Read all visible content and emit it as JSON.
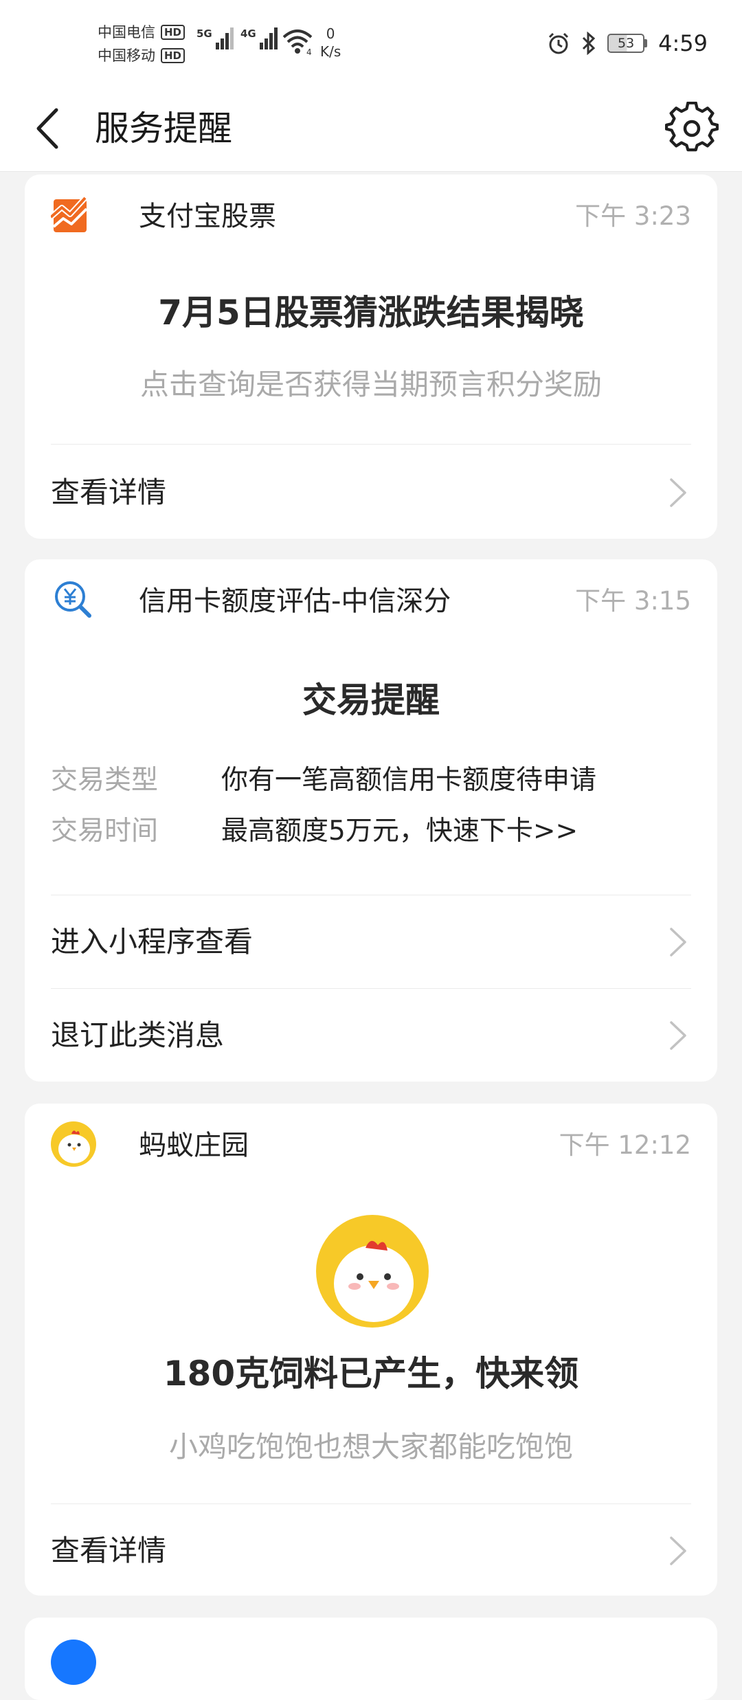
{
  "status_bar": {
    "carrier_1": "中国电信",
    "carrier_2": "中国移动",
    "hd_badge": "HD",
    "sim1_network": "5G",
    "sim2_network": "4G",
    "wifi_badge": "4",
    "speed_value": "0",
    "speed_unit": "K/s",
    "battery": "53",
    "time": "4:59",
    "icons": [
      "signal-icon",
      "wifi-icon",
      "alarm-icon",
      "bluetooth-icon",
      "battery-icon"
    ]
  },
  "header": {
    "title": "服务提醒",
    "icons": [
      "back-arrow-icon",
      "gear-icon"
    ]
  },
  "cards": [
    {
      "service": "支付宝股票",
      "time": "下午 3:23",
      "title": "7月5日股票猜涨跌结果揭晓",
      "subtitle": "点击查询是否获得当期预言积分奖励",
      "link": "查看详情",
      "icon": "stock-chart-icon",
      "icon_color": "#f06a20"
    },
    {
      "service": "信用卡额度评估-中信深分",
      "time": "下午 3:15",
      "title": "交易提醒",
      "fields": [
        {
          "key": "交易类型",
          "value": "你有一笔高额信用卡额度待申请"
        },
        {
          "key": "交易时间",
          "value": "最高额度5万元，快速下卡>>"
        }
      ],
      "links": [
        "进入小程序查看",
        "退订此类消息"
      ],
      "icon": "yuan-search-icon",
      "icon_color": "#2d7fd3"
    },
    {
      "service": "蚂蚁庄园",
      "time": "下午 12:12",
      "title": "180克饲料已产生，快来领",
      "subtitle": "小鸡吃饱饱也想大家都能吃饱饱",
      "link": "查看详情",
      "icon": "chick-avatar-icon",
      "icon_color": "#f7c928"
    }
  ]
}
